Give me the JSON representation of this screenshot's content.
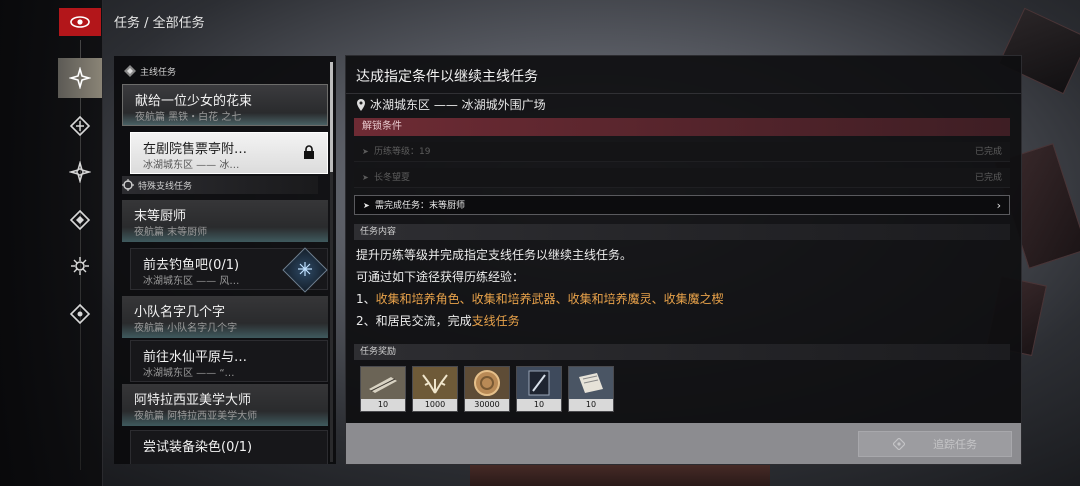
{
  "breadcrumb": "任务 / 全部任务",
  "rail": {
    "icons": [
      "eye-logo-icon",
      "quest-star-icon",
      "diamond-feather-icon",
      "compass-icon",
      "diamond-icon",
      "gear-sun-icon",
      "diamond-eye-icon"
    ]
  },
  "list": {
    "main_header": "主线任务",
    "side_header": "特殊支线任务",
    "items": [
      {
        "title": "献给一位少女的花束",
        "subtitle": "夜航篇 黑铁・白花 之七",
        "kind": "main"
      },
      {
        "title": "在剧院售票亭附…",
        "subtitle": "冰湖城东区 —— 冰…",
        "kind": "selected",
        "locked": true
      },
      {
        "title": "末等厨师",
        "subtitle": "夜航篇 末等厨师",
        "kind": "side"
      },
      {
        "title": "前去钓鱼吧(0/1)",
        "subtitle": "冰湖城东区 —— 风…",
        "kind": "sub",
        "gem": true
      },
      {
        "title": "小队名字几个字",
        "subtitle": "夜航篇 小队名字几个字",
        "kind": "side"
      },
      {
        "title": "前往水仙平原与…",
        "subtitle": "冰湖城东区 —— “…",
        "kind": "sub"
      },
      {
        "title": "阿特拉西亚美学大师",
        "subtitle": "夜航篇 阿特拉西亚美学大师",
        "kind": "side"
      },
      {
        "title": "尝试装备染色(0/1)",
        "subtitle": "",
        "kind": "sub"
      }
    ]
  },
  "detail": {
    "title": "达成指定条件以继续主线任务",
    "location": "冰湖城东区 —— 冰湖城外围广场",
    "unlock_header": "解锁条件",
    "conditions": [
      {
        "label": "历练等级：19",
        "status": "已完成",
        "done": true
      },
      {
        "label": "长冬望夏",
        "status": "已完成",
        "done": true
      },
      {
        "label": "需完成任务：末等厨师",
        "status": "",
        "done": false
      }
    ],
    "content_header": "任务内容",
    "line1": "提升历练等级并完成指定支线任务以继续主线任务。",
    "line2": "可通过如下途径获得历练经验：",
    "line3_prefix": "1、",
    "line3_hl": "收集和培养角色、收集和培养武器、收集和培养魔灵、收集魔之楔",
    "line4_prefix": "2、和居民交流，完成",
    "line4_hl": "支线任务",
    "reward_header": "任务奖励",
    "rewards": [
      {
        "icon": "scroll-item-icon",
        "qty": "10"
      },
      {
        "icon": "antler-emblem-icon",
        "qty": "1000"
      },
      {
        "icon": "gold-coin-icon",
        "qty": "30000"
      },
      {
        "icon": "blade-card-icon",
        "qty": "10"
      },
      {
        "icon": "book-item-icon",
        "qty": "10"
      }
    ],
    "track_button": "追踪任务"
  },
  "colors": {
    "accent_red": "#b3161a",
    "highlight": "#e8a24a",
    "unlock_bar": "#6e2b34"
  }
}
